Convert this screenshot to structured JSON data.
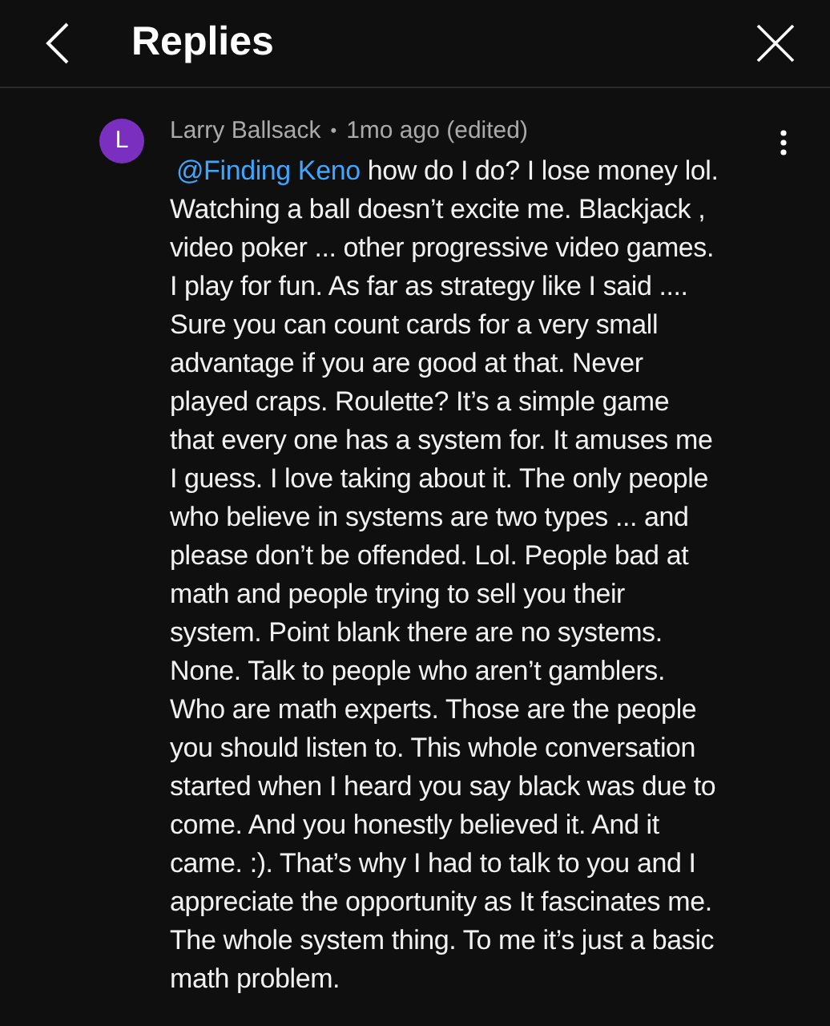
{
  "header": {
    "title": "Replies"
  },
  "comment": {
    "avatar_letter": "L",
    "author": "Larry Ballsack",
    "separator": "•",
    "time": "1mo ago (edited)",
    "mention": "@Finding Keno",
    "lines": [
      " how do I do? I lose money lol.",
      "Watching a ball doesn’t excite me. Blackjack ,",
      "video poker ... other progressive video games.",
      "I play for fun. As far as strategy like I said ....",
      "Sure you can count cards for a very small",
      "advantage if you are good at that. Never",
      "played craps. Roulette?  It’s a simple game",
      "that every one has a system for. It amuses me",
      "I guess. I love taking about it. The only people",
      "who believe in systems are two types ... and",
      "please don’t be offended. Lol. People bad at",
      "math and people trying to sell you their",
      "system. Point blank there are no systems.",
      "None. Talk to people who aren’t gamblers.",
      "Who are math experts. Those are the people",
      "you should listen to. This whole conversation",
      "started when I heard you say black was due to",
      "come. And you honestly believed it. And it",
      "came. :).   That’s why I had to talk to you and I",
      "appreciate the opportunity as It fascinates me.",
      "The whole system thing. To me it’s just a basic",
      "math problem."
    ]
  }
}
